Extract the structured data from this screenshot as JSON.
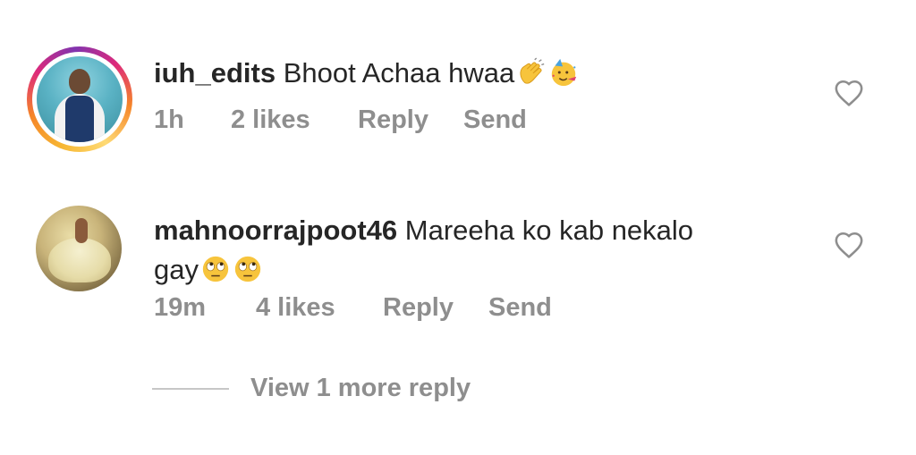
{
  "comments": [
    {
      "username": "iuh_edits",
      "text": "Bhoot Achaa hwaa",
      "emojis": [
        "clapping-hands-emoji",
        "partying-face-emoji"
      ],
      "time": "1h",
      "likes": "2 likes",
      "reply_label": "Reply",
      "send_label": "Send",
      "has_story_ring": true
    },
    {
      "username": "mahnoorrajpoot46",
      "text_line1": "Mareeha ko kab nekalo",
      "text_line2": "gay",
      "emojis": [
        "face-with-rolling-eyes-emoji",
        "face-with-rolling-eyes-emoji"
      ],
      "time": "19m",
      "likes": "4 likes",
      "reply_label": "Reply",
      "send_label": "Send",
      "has_story_ring": false
    }
  ],
  "view_more_replies": "View 1 more reply",
  "icons": {
    "like": "heart-outline-icon"
  },
  "colors": {
    "primary_text": "#262626",
    "secondary_text": "#8e8e8e",
    "story_ring_start": "#f58529",
    "story_ring_end": "#dd2a7b"
  }
}
